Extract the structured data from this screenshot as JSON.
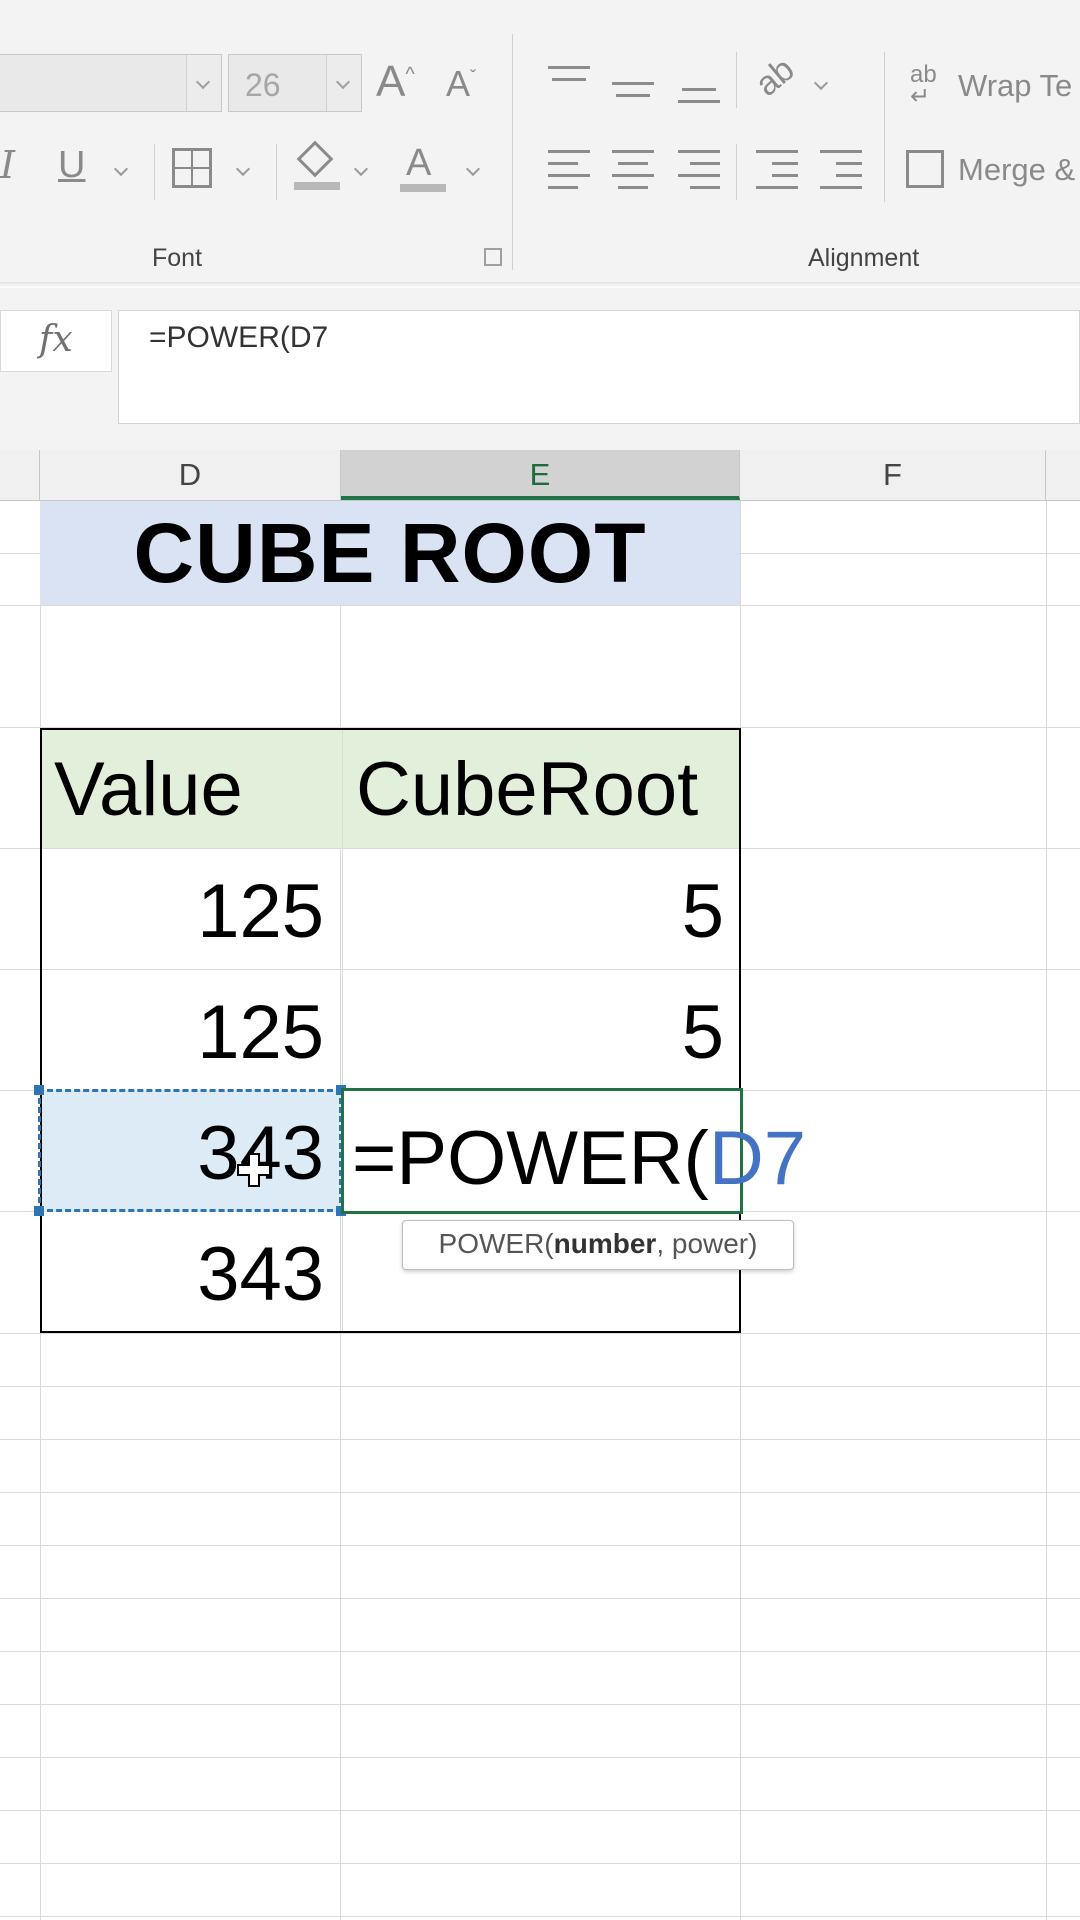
{
  "ribbon": {
    "font_size": "26",
    "wrap_text_label": "Wrap Te",
    "merge_label": "Merge &",
    "font_group_label": "Font",
    "alignment_group_label": "Alignment"
  },
  "formula_bar": {
    "fx_label": "fx",
    "formula": "=POWER(D7"
  },
  "columns": [
    "D",
    "E",
    "F"
  ],
  "sheet": {
    "title": "CUBE ROOT",
    "header_value": "Value",
    "header_cuberoot": "CubeRoot",
    "rows": [
      {
        "value": "125",
        "cuberoot": "5"
      },
      {
        "value": "125",
        "cuberoot": "5"
      },
      {
        "value": "343",
        "cuberoot": ""
      },
      {
        "value": "343",
        "cuberoot": ""
      }
    ]
  },
  "editing": {
    "prefix": "=POWER(",
    "reference": "D7"
  },
  "tooltip": {
    "func": "POWER(",
    "arg_bold": "number",
    "rest": ", power)"
  },
  "colors": {
    "title_fill": "#dae3f3",
    "header_fill": "#e2efda",
    "selection_fill": "#ddebf7",
    "excel_green": "#217346",
    "reference_blue": "#4472c4"
  }
}
